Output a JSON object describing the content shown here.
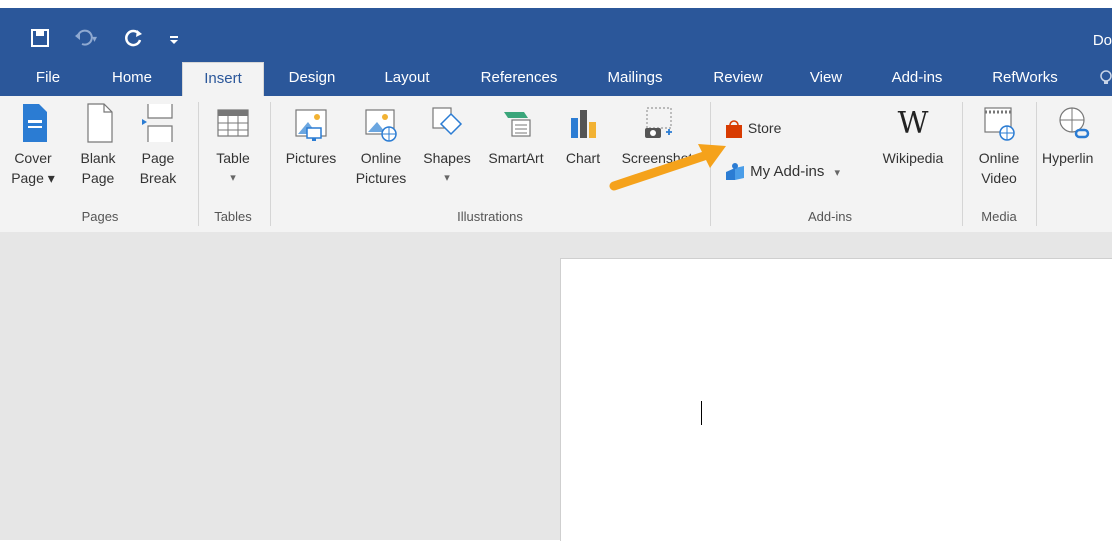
{
  "title_bar": {
    "doc_title_partial": "Do",
    "qat": {
      "save_icon": "save-icon",
      "undo_icon": "undo-icon",
      "redo_icon": "redo-icon",
      "customize_icon": "customize-qat-icon"
    }
  },
  "tabs": [
    "File",
    "Home",
    "Insert",
    "Design",
    "Layout",
    "References",
    "Mailings",
    "Review",
    "View",
    "Add-ins",
    "RefWorks"
  ],
  "active_tab": "Insert",
  "ribbon": {
    "pages": {
      "group": "Pages",
      "cover_page": [
        "Cover",
        "Page ▾"
      ],
      "blank_page": [
        "Blank",
        "Page"
      ],
      "page_break": [
        "Page",
        "Break"
      ]
    },
    "tables": {
      "group": "Tables",
      "table": [
        "Table",
        "▾"
      ]
    },
    "illustrations": {
      "group": "Illustrations",
      "pictures": "Pictures",
      "online_pictures": [
        "Online",
        "Pictures"
      ],
      "shapes": [
        "Shapes",
        "▾"
      ],
      "smartart": "SmartArt",
      "chart": "Chart",
      "screenshot": "Screenshot"
    },
    "addins": {
      "group": "Add-ins",
      "store": "Store",
      "my_addins": "My Add-ins",
      "my_addins_arrow": "▾",
      "wikipedia": "Wikipedia",
      "wikipedia_glyph": "W"
    },
    "media": {
      "group": "Media",
      "online_video": [
        "Online",
        "Video"
      ]
    },
    "links": {
      "hyperlink": "Hyperlin"
    }
  },
  "colors": {
    "brand": "#2b579a",
    "store": "#d83b01",
    "arrow": "#f5a21b"
  }
}
